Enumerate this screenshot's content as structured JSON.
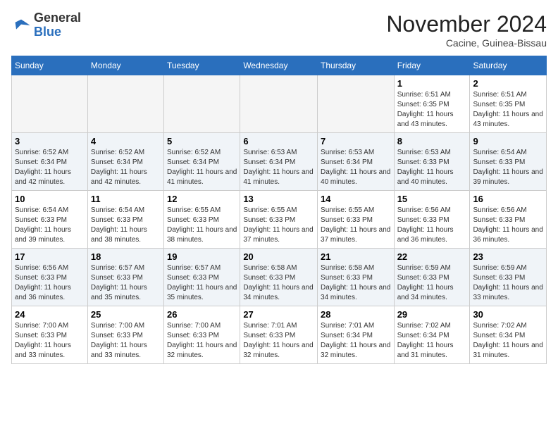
{
  "logo": {
    "general": "General",
    "blue": "Blue"
  },
  "title": "November 2024",
  "location": "Cacine, Guinea-Bissau",
  "days_header": [
    "Sunday",
    "Monday",
    "Tuesday",
    "Wednesday",
    "Thursday",
    "Friday",
    "Saturday"
  ],
  "weeks": [
    [
      {
        "day": "",
        "info": ""
      },
      {
        "day": "",
        "info": ""
      },
      {
        "day": "",
        "info": ""
      },
      {
        "day": "",
        "info": ""
      },
      {
        "day": "",
        "info": ""
      },
      {
        "day": "1",
        "info": "Sunrise: 6:51 AM\nSunset: 6:35 PM\nDaylight: 11 hours and 43 minutes."
      },
      {
        "day": "2",
        "info": "Sunrise: 6:51 AM\nSunset: 6:35 PM\nDaylight: 11 hours and 43 minutes."
      }
    ],
    [
      {
        "day": "3",
        "info": "Sunrise: 6:52 AM\nSunset: 6:34 PM\nDaylight: 11 hours and 42 minutes."
      },
      {
        "day": "4",
        "info": "Sunrise: 6:52 AM\nSunset: 6:34 PM\nDaylight: 11 hours and 42 minutes."
      },
      {
        "day": "5",
        "info": "Sunrise: 6:52 AM\nSunset: 6:34 PM\nDaylight: 11 hours and 41 minutes."
      },
      {
        "day": "6",
        "info": "Sunrise: 6:53 AM\nSunset: 6:34 PM\nDaylight: 11 hours and 41 minutes."
      },
      {
        "day": "7",
        "info": "Sunrise: 6:53 AM\nSunset: 6:34 PM\nDaylight: 11 hours and 40 minutes."
      },
      {
        "day": "8",
        "info": "Sunrise: 6:53 AM\nSunset: 6:33 PM\nDaylight: 11 hours and 40 minutes."
      },
      {
        "day": "9",
        "info": "Sunrise: 6:54 AM\nSunset: 6:33 PM\nDaylight: 11 hours and 39 minutes."
      }
    ],
    [
      {
        "day": "10",
        "info": "Sunrise: 6:54 AM\nSunset: 6:33 PM\nDaylight: 11 hours and 39 minutes."
      },
      {
        "day": "11",
        "info": "Sunrise: 6:54 AM\nSunset: 6:33 PM\nDaylight: 11 hours and 38 minutes."
      },
      {
        "day": "12",
        "info": "Sunrise: 6:55 AM\nSunset: 6:33 PM\nDaylight: 11 hours and 38 minutes."
      },
      {
        "day": "13",
        "info": "Sunrise: 6:55 AM\nSunset: 6:33 PM\nDaylight: 11 hours and 37 minutes."
      },
      {
        "day": "14",
        "info": "Sunrise: 6:55 AM\nSunset: 6:33 PM\nDaylight: 11 hours and 37 minutes."
      },
      {
        "day": "15",
        "info": "Sunrise: 6:56 AM\nSunset: 6:33 PM\nDaylight: 11 hours and 36 minutes."
      },
      {
        "day": "16",
        "info": "Sunrise: 6:56 AM\nSunset: 6:33 PM\nDaylight: 11 hours and 36 minutes."
      }
    ],
    [
      {
        "day": "17",
        "info": "Sunrise: 6:56 AM\nSunset: 6:33 PM\nDaylight: 11 hours and 36 minutes."
      },
      {
        "day": "18",
        "info": "Sunrise: 6:57 AM\nSunset: 6:33 PM\nDaylight: 11 hours and 35 minutes."
      },
      {
        "day": "19",
        "info": "Sunrise: 6:57 AM\nSunset: 6:33 PM\nDaylight: 11 hours and 35 minutes."
      },
      {
        "day": "20",
        "info": "Sunrise: 6:58 AM\nSunset: 6:33 PM\nDaylight: 11 hours and 34 minutes."
      },
      {
        "day": "21",
        "info": "Sunrise: 6:58 AM\nSunset: 6:33 PM\nDaylight: 11 hours and 34 minutes."
      },
      {
        "day": "22",
        "info": "Sunrise: 6:59 AM\nSunset: 6:33 PM\nDaylight: 11 hours and 34 minutes."
      },
      {
        "day": "23",
        "info": "Sunrise: 6:59 AM\nSunset: 6:33 PM\nDaylight: 11 hours and 33 minutes."
      }
    ],
    [
      {
        "day": "24",
        "info": "Sunrise: 7:00 AM\nSunset: 6:33 PM\nDaylight: 11 hours and 33 minutes."
      },
      {
        "day": "25",
        "info": "Sunrise: 7:00 AM\nSunset: 6:33 PM\nDaylight: 11 hours and 33 minutes."
      },
      {
        "day": "26",
        "info": "Sunrise: 7:00 AM\nSunset: 6:33 PM\nDaylight: 11 hours and 32 minutes."
      },
      {
        "day": "27",
        "info": "Sunrise: 7:01 AM\nSunset: 6:33 PM\nDaylight: 11 hours and 32 minutes."
      },
      {
        "day": "28",
        "info": "Sunrise: 7:01 AM\nSunset: 6:34 PM\nDaylight: 11 hours and 32 minutes."
      },
      {
        "day": "29",
        "info": "Sunrise: 7:02 AM\nSunset: 6:34 PM\nDaylight: 11 hours and 31 minutes."
      },
      {
        "day": "30",
        "info": "Sunrise: 7:02 AM\nSunset: 6:34 PM\nDaylight: 11 hours and 31 minutes."
      }
    ]
  ]
}
